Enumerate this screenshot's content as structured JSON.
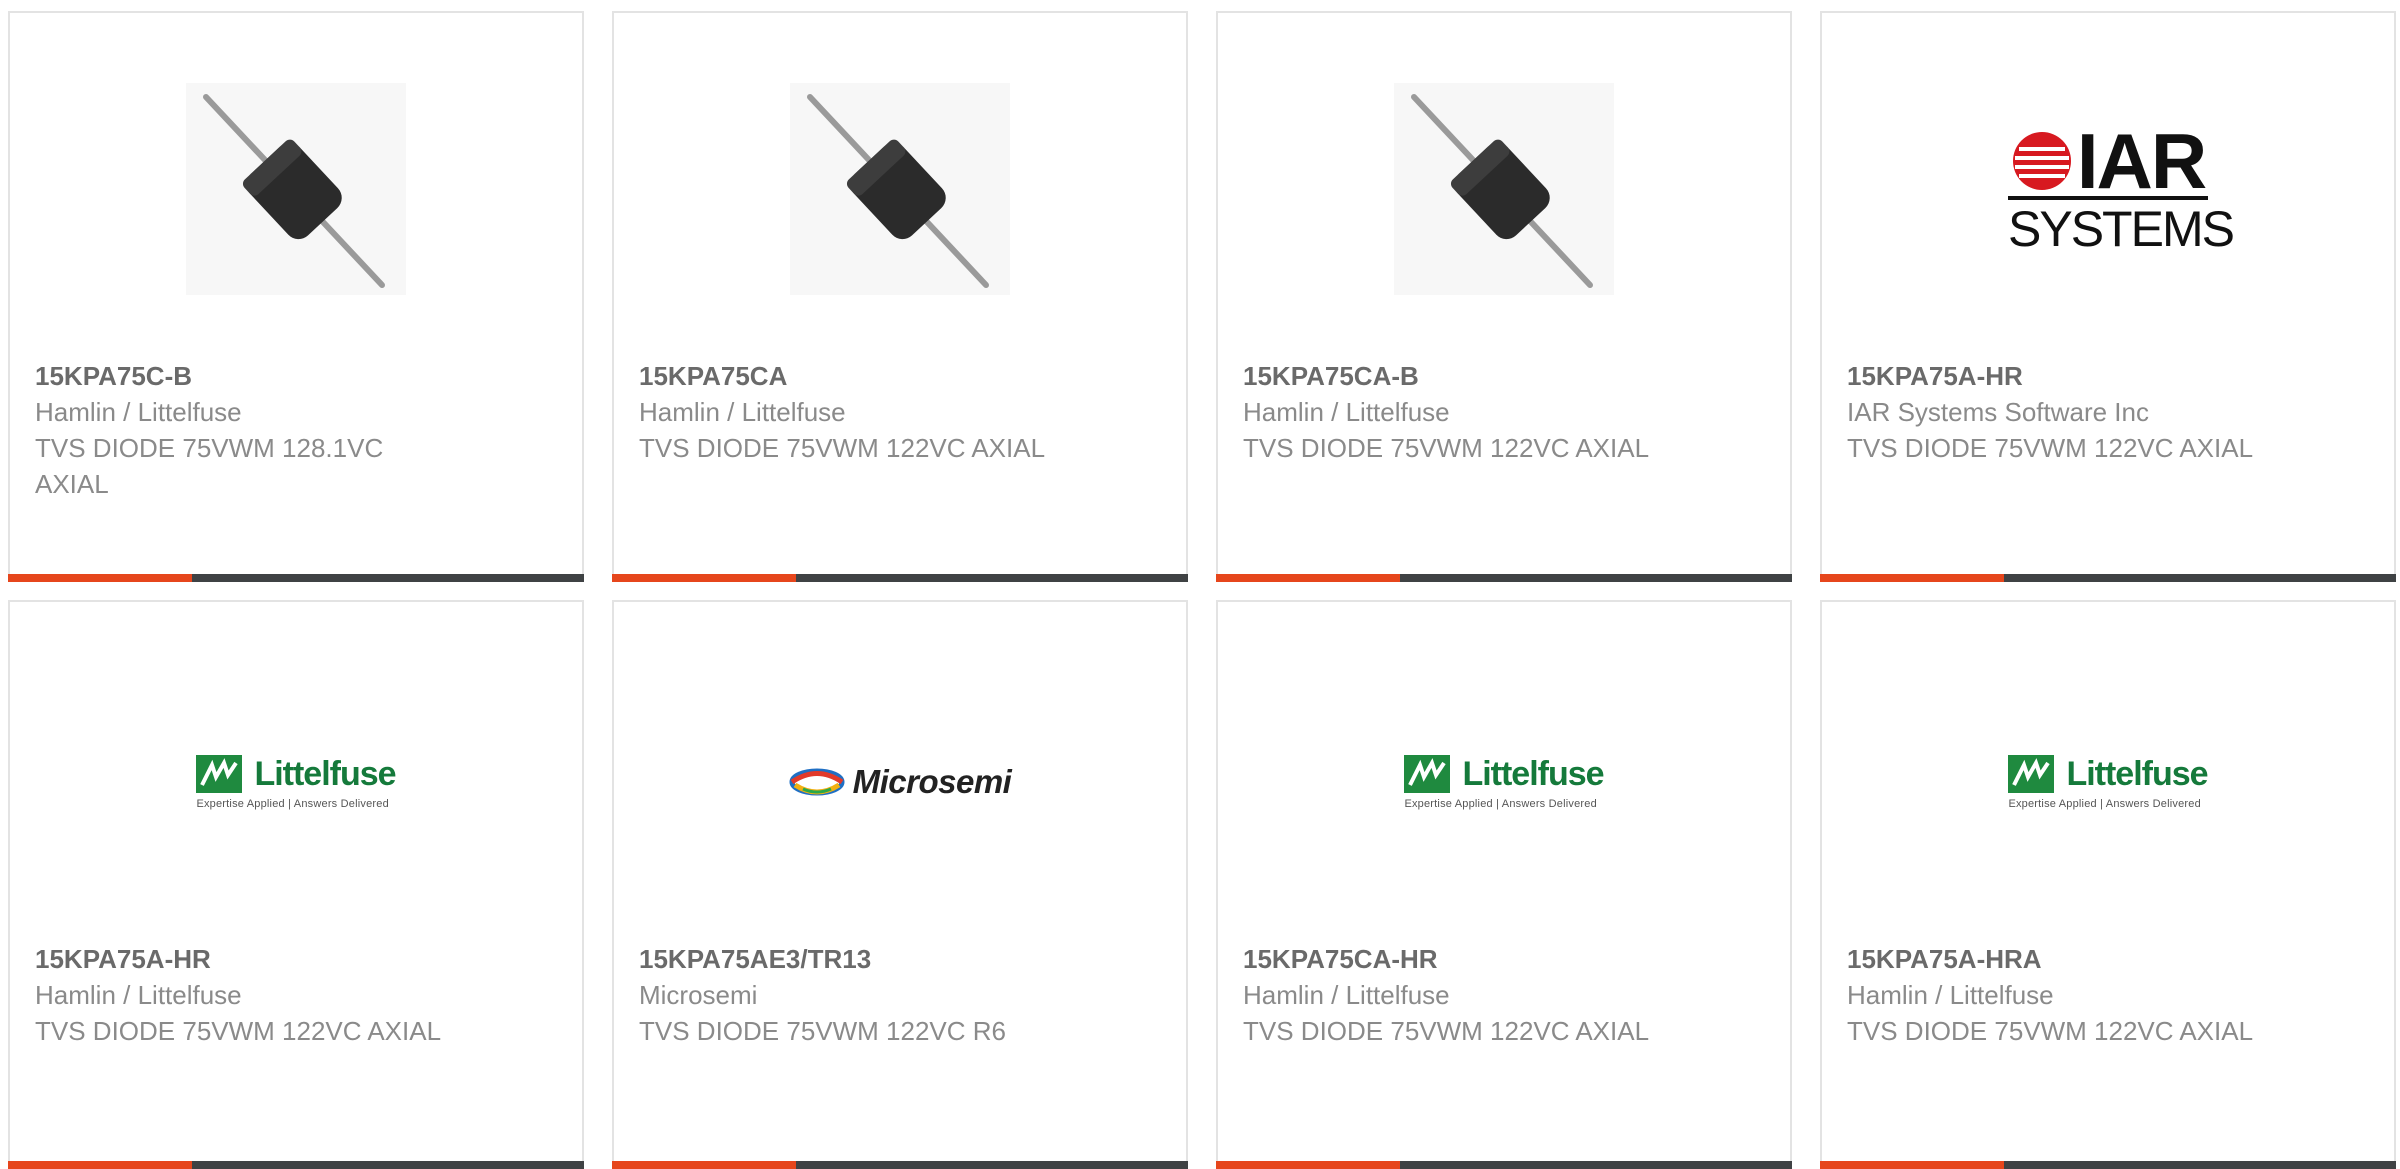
{
  "products": [
    {
      "part": "15KPA75C-B",
      "mfr": "Hamlin / Littelfuse",
      "desc": "TVS DIODE 75VWM 128.1VC AXIAL",
      "image": "diode-axial"
    },
    {
      "part": "15KPA75CA",
      "mfr": "Hamlin / Littelfuse",
      "desc": "TVS DIODE 75VWM 122VC AXIAL",
      "image": "diode-axial"
    },
    {
      "part": "15KPA75CA-B",
      "mfr": "Hamlin / Littelfuse",
      "desc": "TVS DIODE 75VWM 122VC AXIAL",
      "image": "diode-axial"
    },
    {
      "part": "15KPA75A-HR",
      "mfr": "IAR Systems Software Inc",
      "desc": "TVS DIODE 75VWM 122VC AXIAL",
      "image": "iar-logo",
      "logo_text": "IAR",
      "logo_sub": "SYSTEMS"
    },
    {
      "part": "15KPA75A-HR",
      "mfr": "Hamlin / Littelfuse",
      "desc": "TVS DIODE 75VWM 122VC AXIAL",
      "image": "littelfuse-logo",
      "logo_text": "Littelfuse",
      "logo_tag": "Expertise Applied | Answers Delivered"
    },
    {
      "part": "15KPA75AE3/TR13",
      "mfr": "Microsemi",
      "desc": "TVS DIODE 75VWM 122VC R6",
      "image": "microsemi-logo",
      "logo_text": "Microsemi"
    },
    {
      "part": "15KPA75CA-HR",
      "mfr": "Hamlin / Littelfuse",
      "desc": "TVS DIODE 75VWM 122VC AXIAL",
      "image": "littelfuse-logo",
      "logo_text": "Littelfuse",
      "logo_tag": "Expertise Applied | Answers Delivered"
    },
    {
      "part": "15KPA75A-HRA",
      "mfr": "Hamlin / Littelfuse",
      "desc": "TVS DIODE 75VWM 122VC AXIAL",
      "image": "littelfuse-logo",
      "logo_text": "Littelfuse",
      "logo_tag": "Expertise Applied | Answers Delivered"
    }
  ],
  "colors": {
    "accent": "#e6461c",
    "bar": "#3f4244",
    "littelfuse_green": "#157a3b"
  }
}
